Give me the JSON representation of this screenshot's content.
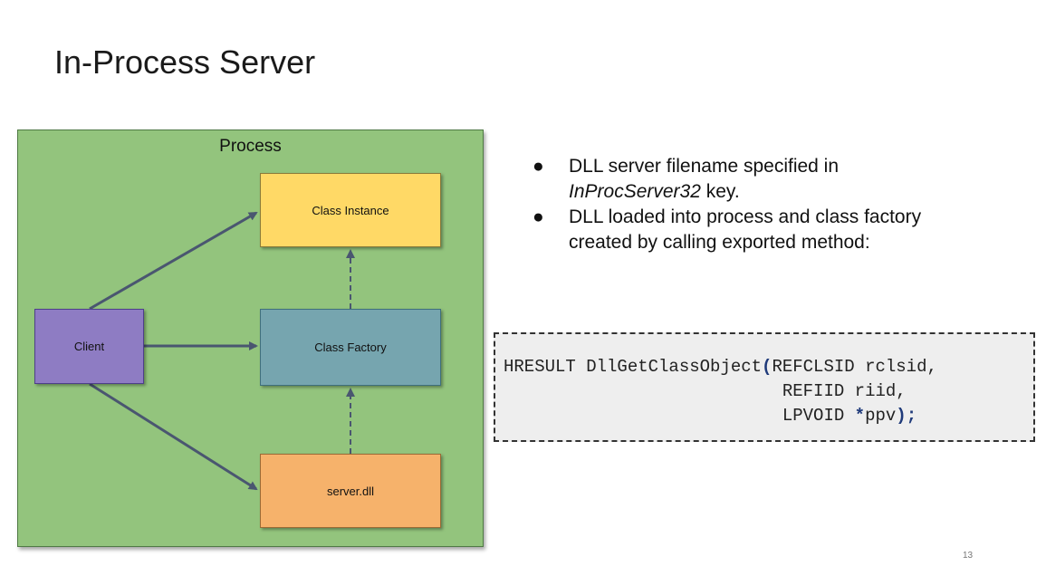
{
  "slide": {
    "title": "In-Process Server",
    "page_number": "13"
  },
  "diagram": {
    "process_label": "Process",
    "nodes": {
      "class_instance": "Class Instance",
      "class_factory": "Class Factory",
      "server_dll": "server.dll",
      "client": "Client"
    },
    "colors": {
      "process_bg": "#93c47d",
      "class_instance": "#ffd966",
      "class_factory": "#76a5af",
      "server_dll": "#f6b26b",
      "client": "#8e7cc3",
      "arrow": "#4a5670"
    }
  },
  "bullets": {
    "b1_line1": "DLL server filename specified in",
    "b1_italic": "InProcServer32",
    "b1_rest": " key.",
    "b2_line1": "DLL loaded into process and class factory",
    "b2_line2": "created by calling exported method:"
  },
  "code": {
    "l1_a": "HRESULT DllGetClassObject",
    "l1_paren": "(",
    "l1_b": "REFCLSID rclsid,",
    "l2": "                           REFIID riid,",
    "l3_a": "                           LPVOID ",
    "l3_star": "*",
    "l3_b": "ppv",
    "l3_end": ");"
  }
}
